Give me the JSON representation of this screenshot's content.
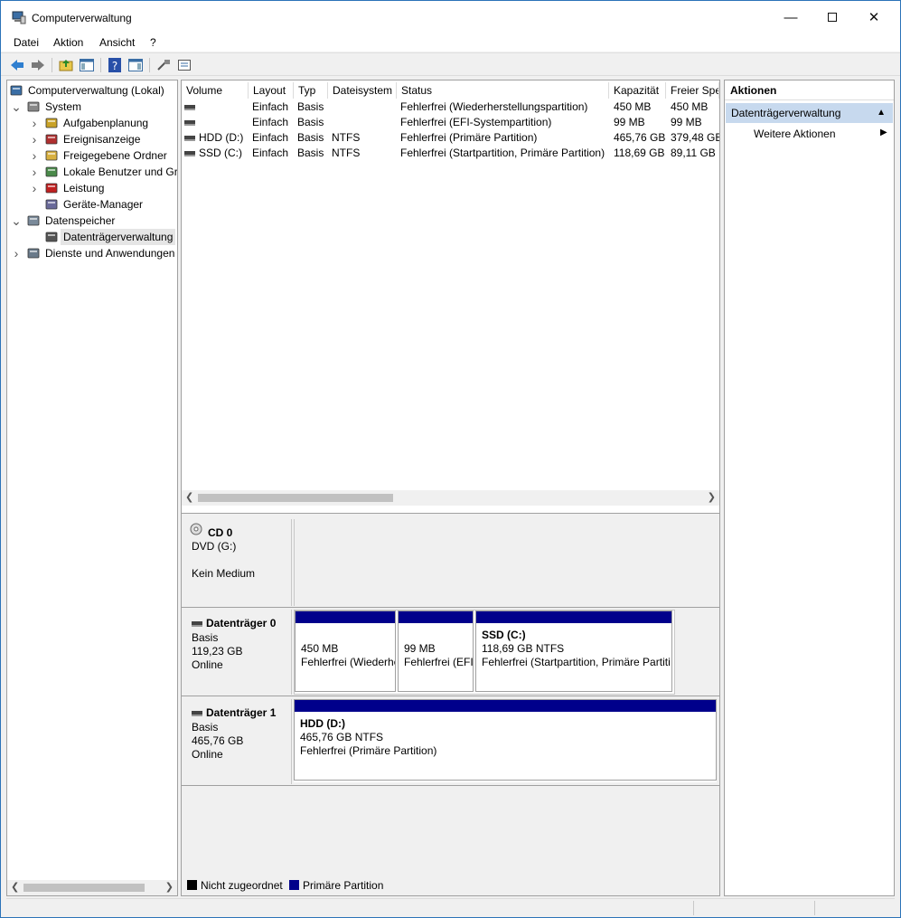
{
  "window": {
    "title": "Computerverwaltung"
  },
  "menu": [
    "Datei",
    "Aktion",
    "Ansicht",
    "?"
  ],
  "tree": [
    {
      "label": "Computerverwaltung (Lokal)",
      "level": 0,
      "chev": "",
      "icon": "computer-management-icon"
    },
    {
      "label": "System",
      "level": 1,
      "chev": "v",
      "icon": "system-tools-icon"
    },
    {
      "label": "Aufgabenplanung",
      "level": 2,
      "chev": ">",
      "icon": "task-scheduler-icon"
    },
    {
      "label": "Ereignisanzeige",
      "level": 2,
      "chev": ">",
      "icon": "event-viewer-icon"
    },
    {
      "label": "Freigegebene Ordner",
      "level": 2,
      "chev": ">",
      "icon": "shared-folders-icon"
    },
    {
      "label": "Lokale Benutzer und Gruppen",
      "level": 2,
      "chev": ">",
      "icon": "local-users-icon"
    },
    {
      "label": "Leistung",
      "level": 2,
      "chev": ">",
      "icon": "performance-icon"
    },
    {
      "label": "Geräte-Manager",
      "level": 2,
      "chev": "",
      "icon": "device-manager-icon"
    },
    {
      "label": "Datenspeicher",
      "level": 1,
      "chev": "v",
      "icon": "storage-icon"
    },
    {
      "label": "Datenträgerverwaltung",
      "level": 2,
      "chev": "",
      "icon": "disk-management-icon",
      "selected": true
    },
    {
      "label": "Dienste und Anwendungen",
      "level": 1,
      "chev": ">",
      "icon": "services-icon"
    }
  ],
  "volume_list": {
    "columns": [
      "Volume",
      "Layout",
      "Typ",
      "Dateisystem",
      "Status",
      "Kapazität",
      "Freier Spe"
    ],
    "rows": [
      {
        "volume": "",
        "layout": "Einfach",
        "typ": "Basis",
        "fs": "",
        "status": "Fehlerfrei (Wiederherstellungspartition)",
        "cap": "450 MB",
        "free": "450 MB"
      },
      {
        "volume": "",
        "layout": "Einfach",
        "typ": "Basis",
        "fs": "",
        "status": "Fehlerfrei (EFI-Systempartition)",
        "cap": "99 MB",
        "free": "99 MB"
      },
      {
        "volume": "HDD (D:)",
        "layout": "Einfach",
        "typ": "Basis",
        "fs": "NTFS",
        "status": "Fehlerfrei (Primäre Partition)",
        "cap": "465,76 GB",
        "free": "379,48 GB"
      },
      {
        "volume": "SSD (C:)",
        "layout": "Einfach",
        "typ": "Basis",
        "fs": "NTFS",
        "status": "Fehlerfrei (Startpartition, Primäre Partition)",
        "cap": "118,69 GB",
        "free": "89,11 GB"
      }
    ]
  },
  "disks": {
    "cd0": {
      "name": "CD 0",
      "line1": "DVD (G:)",
      "line2": "Kein Medium"
    },
    "disk0": {
      "name": "Datenträger 0",
      "type": "Basis",
      "size": "119,23 GB",
      "status": "Online",
      "partitions": [
        {
          "title": "",
          "size": "450 MB",
          "status": "Fehlerfrei (Wiederherstellungspartition)"
        },
        {
          "title": "",
          "size": "99 MB",
          "status": "Fehlerfrei (EFI-Systempartition)"
        },
        {
          "title": "SSD  (C:)",
          "size": "118,69 GB NTFS",
          "status": "Fehlerfrei (Startpartition, Primäre Partition)"
        }
      ]
    },
    "disk1": {
      "name": "Datenträger 1",
      "type": "Basis",
      "size": "465,76 GB",
      "status": "Online",
      "partitions": [
        {
          "title": "HDD  (D:)",
          "size": "465,76 GB NTFS",
          "status": "Fehlerfrei (Primäre Partition)"
        }
      ]
    }
  },
  "legend": [
    {
      "label": "Nicht zugeordnet",
      "color": "#000000"
    },
    {
      "label": "Primäre Partition",
      "color": "#00008b"
    }
  ],
  "actions": {
    "header": "Aktionen",
    "section": "Datenträgerverwaltung",
    "item": "Weitere Aktionen"
  },
  "colors": {
    "partition_bar": "#00008b",
    "selection": "#c7d9ee",
    "window_border": "#2b73b8"
  }
}
